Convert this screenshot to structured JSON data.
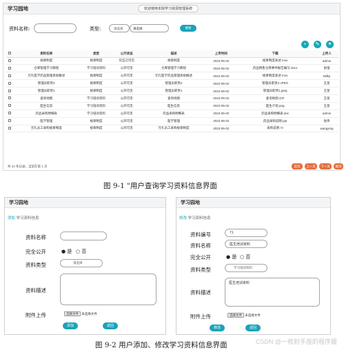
{
  "top": {
    "title": "学习园地",
    "welcome": "欢迎使用本院学习资源管理系统",
    "search": {
      "name_label": "资料名称:",
      "type_label": "类型:",
      "type_placeholder": "请选择",
      "type_value": "请选择",
      "search_button": "搜索"
    },
    "toolbar": {
      "add": "+",
      "edit": "✎",
      "delete": "🗑"
    },
    "table": {
      "headers": [
        "资料名称",
        "类型",
        "公开状态",
        "描述",
        "上传时间",
        "下载",
        "上传人"
      ],
      "rows": [
        [
          "规章制度",
          "规章制度",
          "仅自己可见",
          "规章制度",
          "2022-05-02",
          "规章制度表述.mov",
          "admin"
        ],
        [
          "仓库管理学习教程",
          "学习培训资料",
          "公开可见",
          "仓库管理学习教程",
          "2022-05-02",
          "药品销售仓库事件报告编写.docx",
          "张强"
        ],
        [
          "元礼医学药品管理系统概述",
          "规章制度",
          "公开可见",
          "元礼医学药品管理系统概述",
          "2022-05-02",
          "规章制度表述.mov",
          "Milky"
        ],
        [
          "管理员职责2",
          "规章制度",
          "公开可见",
          "管理员职责2",
          "2022-05-02",
          "管理员职责2.JPEG",
          "王星"
        ],
        [
          "管理员职责1",
          "规章制度",
          "公开可见",
          "管理员职责1",
          "2022-05-02",
          "管理员职责1.jpeg",
          "王星"
        ],
        [
          "查询地图",
          "学习培训资料",
          "公开可见",
          "查询地图",
          "2022-05-02",
          "查询地图.GIF",
          "王星"
        ],
        [
          "医生信息",
          "学习培训资料",
          "公开可见",
          "医生信息",
          "2022-05-02",
          "医生介绍.png",
          "王星"
        ],
        [
          "药品采购明细表",
          "学习培训资料",
          "公开可见",
          "药品采购明细表",
          "2022-05-02",
          "药品采购明细表.doc",
          "admin"
        ],
        [
          "医学管理",
          "规章制度",
          "公开可见",
          "医学管理",
          "2022-05-02",
          "药品采购说明.ppt",
          "张伟"
        ],
        [
          "元礼员工采购规章制度",
          "规章制度",
          "公开可见",
          "元礼员工采购规章制度",
          "2022-05-02",
          "采购说明.7z",
          "wangxing"
        ]
      ]
    },
    "pager": {
      "info": "共 22 条记录，当前在第 1 页",
      "first": "首页",
      "prev": "上一页",
      "next": "下一页",
      "last": "尾页"
    }
  },
  "caption1": "图 9-1 \"用户查询学习资料信息界面",
  "add_form": {
    "title": "学习园地",
    "crumb_action": "添加",
    "crumb_rest": "学习资料信息",
    "name_label": "资料名称",
    "public_label": "完全公开",
    "radio_yes": "● 是",
    "radio_no": "○ 否",
    "type_label": "资料类型",
    "type_placeholder": "请选择",
    "desc_label": "资料描述",
    "upload_label": "附件上传",
    "file_button": "选择文件",
    "file_text": "未选择文件",
    "add_button": "添加",
    "back_button": "返回"
  },
  "edit_form": {
    "title": "学习园地",
    "crumb_action": "修改",
    "crumb_rest": "学习资料信息",
    "id_label": "资料编号",
    "id_value": "71",
    "name_label": "资料名称",
    "name_value": "医生培训资料",
    "public_label": "完全公开",
    "radio_yes": "● 是",
    "radio_no": "○ 否",
    "type_label": "资料类型",
    "type_value": "学习培训资料",
    "desc_label": "资料描述",
    "desc_value": "医生培训资料",
    "upload_label": "附件上传",
    "file_button": "选择文件",
    "file_text": "未选择文件",
    "edit_button": "修改",
    "back_button": "返回"
  },
  "caption2": "图 9-2 用户添加、修改学习资料信息界面",
  "watermark": "CSDN @一枚射手座的程序媛"
}
